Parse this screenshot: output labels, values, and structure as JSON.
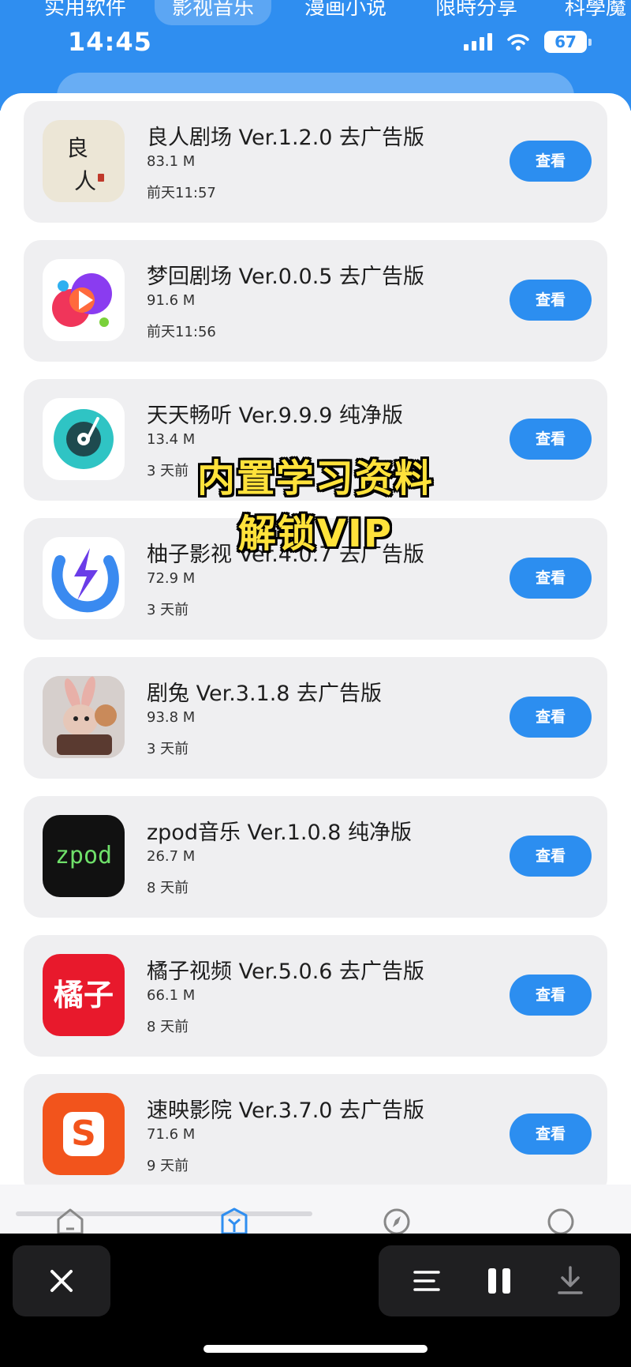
{
  "tabs": [
    "实用软件",
    "影视音乐",
    "漫画小说",
    "限時分享",
    "科學魔"
  ],
  "status": {
    "time": "14:45",
    "battery": "67"
  },
  "accent": "#2f8ef0",
  "apps": [
    {
      "title": "良人剧场 Ver.1.2.0 去广告版",
      "size": "83.1 M",
      "date": "前天11:57",
      "button": "查看",
      "icon": "liangren-icon"
    },
    {
      "title": "梦回剧场 Ver.0.0.5 去广告版",
      "size": "91.6 M",
      "date": "前天11:56",
      "button": "查看",
      "icon": "menghui-icon"
    },
    {
      "title": "天天畅听 Ver.9.9.9 纯净版",
      "size": "13.4 M",
      "date": "3 天前",
      "button": "查看",
      "icon": "tiantian-icon"
    },
    {
      "title": "柚子影视 Ver.4.0.7 去广告版",
      "size": "72.9 M",
      "date": "3 天前",
      "button": "查看",
      "icon": "youzi-icon"
    },
    {
      "title": "剧兔 Ver.3.1.8 去广告版",
      "size": "93.8 M",
      "date": "3 天前",
      "button": "查看",
      "icon": "jutu-icon"
    },
    {
      "title": "zpod音乐 Ver.1.0.8 纯净版",
      "size": "26.7 M",
      "date": "8 天前",
      "button": "查看",
      "icon": "zpod-icon",
      "icon_text": "zpod"
    },
    {
      "title": "橘子视频 Ver.5.0.6 去广告版",
      "size": "66.1 M",
      "date": "8 天前",
      "button": "查看",
      "icon": "juzi-icon",
      "icon_text": "橘子"
    },
    {
      "title": "速映影院 Ver.3.7.0 去广告版",
      "size": "71.6 M",
      "date": "9 天前",
      "button": "查看",
      "icon": "suying-icon",
      "icon_text": "S"
    }
  ],
  "liangren_icon_text": [
    "良",
    "人"
  ],
  "overlay": {
    "line1": "内置学习资料",
    "line2": "解锁VIP"
  }
}
